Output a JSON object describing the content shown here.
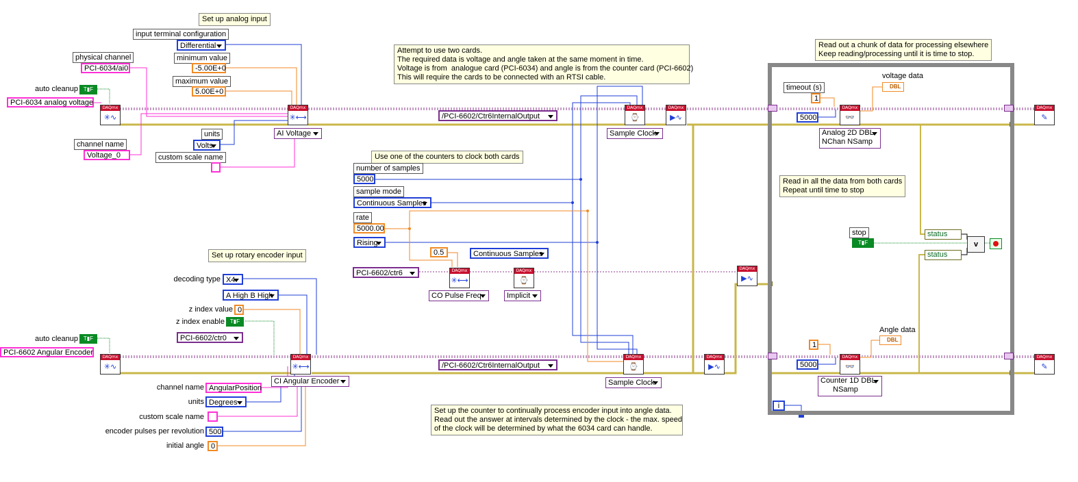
{
  "notes": {
    "setup_analog": "Set up analog input",
    "attempt": "Attempt to use two cards.\nThe required data is voltage and angle taken at the same moment in time.\nVoltage is from  analogue card (PCI-6034) and angle is from the counter card (PCI-6602)\nThis will require the cards to be connected with an RTSI cable.",
    "counters_clock": "Use one of the counters to clock both cards",
    "setup_encoder": "Set up rotary encoder input",
    "read_chunk": "Read out a chunk of data for processing elsewhere\nKeep reading/processing until it is time to stop.",
    "read_both": "Read in all the data from both cards\nRepeat until time to stop",
    "encoder_process": "Set up the counter to continually process encoder input into angle data.\nRead out the answer at intervals determined by the clock - the max. speed\nof the clock will be determined by what the 6034 card can handle."
  },
  "analog": {
    "itc_label": "input terminal configuration",
    "itc_value": "Differential",
    "min_label": "minimum value",
    "min_value": "-5.00E+0",
    "max_label": "maximum value",
    "max_value": "5.00E+0",
    "phys_label": "physical channel",
    "phys_value": "PCI-6034/ai0",
    "autoclean_label": "auto cleanup",
    "task_name": "PCI-6034 analog voltage",
    "units_label": "units",
    "units_value": "Volts",
    "chname_label": "channel name",
    "chname_value": "Voltage_0",
    "scale_label": "custom scale name",
    "selector": "AI Voltage"
  },
  "clock": {
    "terminal_top": "/PCI-6602/Ctr6InternalOutput",
    "terminal_bottom": "/PCI-6602/Ctr6InternalOutput",
    "sample_clock_top": "Sample Clock",
    "sample_clock_bottom": "Sample Clock",
    "nsamples_label": "number of samples",
    "nsamples_value": "5000",
    "mode_label": "sample mode",
    "mode_value": "Continuous Samples",
    "rate_label": "rate",
    "rate_value": "5000.00",
    "edge_value": "Rising",
    "duty_value": "0.5",
    "ctr_mode": "Continuous Samples",
    "ctr_channel": "PCI-6602/ctr6",
    "co_selector": "CO Pulse Freq",
    "implicit": "Implicit"
  },
  "encoder": {
    "decoding_label": "decoding type",
    "decoding_value": "X4",
    "ab_value": "A High B High",
    "zval_label": "z index value",
    "zval_value": "0",
    "zen_label": "z index enable",
    "ctr0": "PCI-6602/ctr0",
    "autoclean_label": "auto cleanup",
    "task_name": "PCI-6602 Angular Encoder",
    "selector": "CI Angular Encoder",
    "chname_label": "channel name",
    "chname_value": "AngularPosition",
    "units_label": "units",
    "units_value": "Degrees",
    "scale_label": "custom scale name",
    "ppr_label": "encoder pulses per revolution",
    "ppr_value": "500",
    "angle_label": "initial angle",
    "angle_value": "0"
  },
  "loop": {
    "timeout_label": "timeout (s)",
    "timeout_value": "1",
    "samples_top": "5000",
    "voltage_label": "voltage data",
    "read_analog": "Analog 2D DBL\nNChan NSamp",
    "stop_label": "stop",
    "status1": "status",
    "status2": "status",
    "ones_value": "1",
    "samples_bottom": "5000",
    "angle_label": "Angle data",
    "read_counter": "Counter 1D DBL\nNSamp",
    "iter": "i",
    "dbl": "DBL",
    "or": "v"
  },
  "colors": {
    "error_wire": "#e3d7a0",
    "task_wire": "#8e3a8e",
    "int_wire": "#1f3fd6",
    "dbl_wire": "#f08a24",
    "string_wire": "#ff2fd6",
    "bool_wire": "#0a8a24"
  }
}
